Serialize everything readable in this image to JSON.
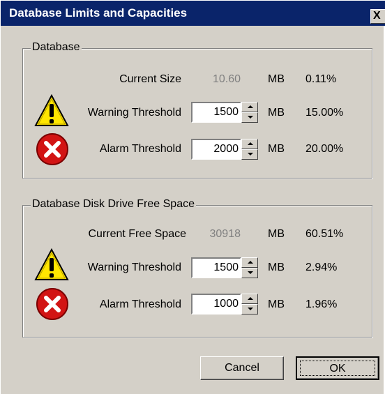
{
  "window": {
    "title": "Database Limits and Capacities",
    "close_glyph": "X"
  },
  "database": {
    "legend": "Database",
    "current_size": {
      "label": "Current Size",
      "value": "10.60",
      "unit": "MB",
      "percent": "0.11%"
    },
    "warning": {
      "label": "Warning Threshold",
      "value": "1500",
      "unit": "MB",
      "percent": "15.00%"
    },
    "alarm": {
      "label": "Alarm Threshold",
      "value": "2000",
      "unit": "MB",
      "percent": "20.00%"
    }
  },
  "disk": {
    "legend": "Database Disk Drive Free Space",
    "current_free": {
      "label": "Current Free Space",
      "value": "30918",
      "unit": "MB",
      "percent": "60.51%"
    },
    "warning": {
      "label": "Warning Threshold",
      "value": "1500",
      "unit": "MB",
      "percent": "2.94%"
    },
    "alarm": {
      "label": "Alarm Threshold",
      "value": "1000",
      "unit": "MB",
      "percent": "1.96%"
    }
  },
  "buttons": {
    "cancel": "Cancel",
    "ok": "OK"
  },
  "icons": {
    "warning": "warning-triangle-icon",
    "alarm": "error-x-icon"
  },
  "colors": {
    "titlebar": "#0a246a",
    "warning_yellow": "#ffe600",
    "error_red": "#d21414"
  }
}
